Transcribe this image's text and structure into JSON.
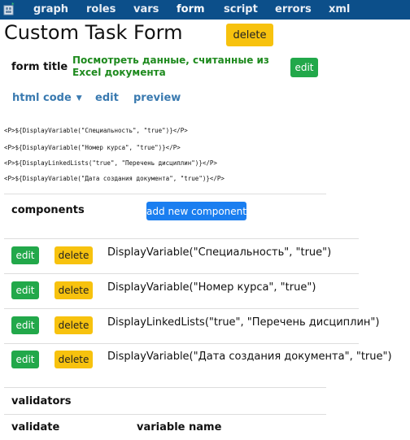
{
  "nav": {
    "items": [
      "graph",
      "roles",
      "vars",
      "form",
      "script",
      "errors",
      "xml"
    ],
    "active": "form"
  },
  "page": {
    "title": "Custom Task Form",
    "delete_label": "delete"
  },
  "form_title": {
    "label": "form title",
    "value": "Посмотреть данные, считанные из Excel документа",
    "edit_label": "edit"
  },
  "tabs": {
    "html_code": "html code",
    "edit": "edit",
    "preview": "preview"
  },
  "html_code_lines": [
    "<P>${DisplayVariable(\"Специальность\", \"true\")}</P>",
    "<P>${DisplayVariable(\"Номер курса\", \"true\")}</P>",
    "<P>${DisplayLinkedLists(\"true\", \"Перечень дисциплин\")}</P>",
    "<P>${DisplayVariable(\"Дата создания документа\", \"true\")}</P>"
  ],
  "components": {
    "title": "components",
    "add_label": "add new component",
    "edit_label": "edit",
    "delete_label": "delete",
    "items": [
      "DisplayVariable(\"Специальность\", \"true\")",
      "DisplayVariable(\"Номер курса\", \"true\")",
      "DisplayLinkedLists(\"true\", \"Перечень дисциплин\")",
      "DisplayVariable(\"Дата создания документа\", \"true\")"
    ]
  },
  "validators": {
    "title": "validators",
    "columns": [
      "validate",
      "variable name"
    ]
  },
  "colors": {
    "nav_bg": "#0c4f8a",
    "yellow": "#f7c20e",
    "green": "#22a84a",
    "blue": "#1a7ef0",
    "title_green": "#1e8a1e",
    "link_blue": "#3a7ab0"
  }
}
